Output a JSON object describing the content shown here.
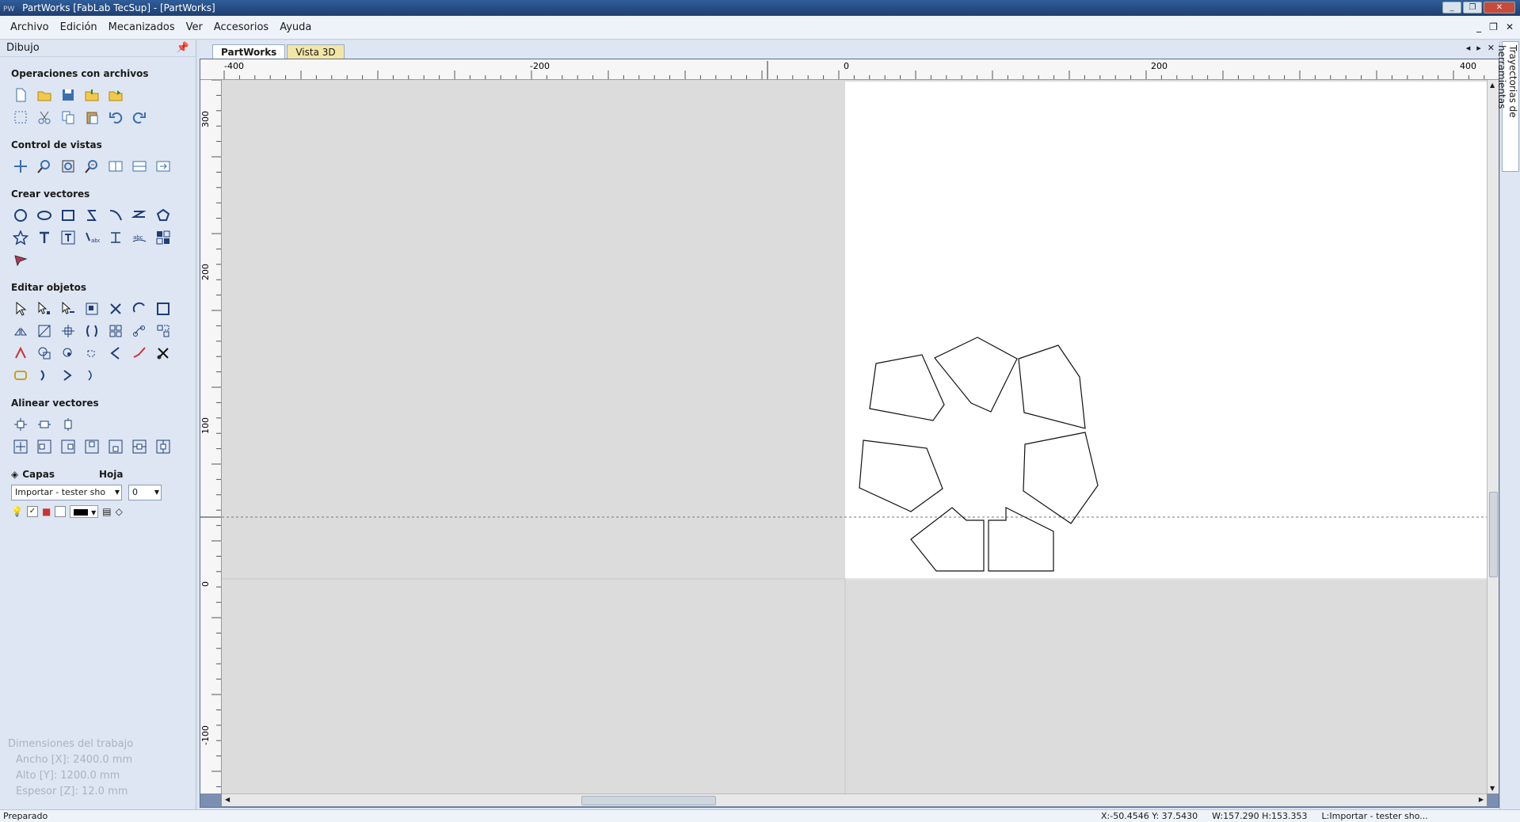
{
  "window": {
    "title": "PartWorks [FabLab TecSup] - [PartWorks]",
    "app_icon": "PW"
  },
  "menu": [
    "Archivo",
    "Edición",
    "Mecanizados",
    "Ver",
    "Accesorios",
    "Ayuda"
  ],
  "left_panel": {
    "title": "Dibujo",
    "sections": {
      "file_ops": "Operaciones con archivos",
      "view_control": "Control de vistas",
      "create_vectors": "Crear vectores",
      "edit_objects": "Editar objetos",
      "align_vectors": "Alinear vectores"
    },
    "layers": {
      "title": "Capas",
      "sheet_title": "Hoja",
      "layer_selected": "Importar - tester sho",
      "sheet_selected": "0"
    },
    "job_dimensions": {
      "title": "Dimensiones del trabajo",
      "width": "Ancho   [X]: 2400.0 mm",
      "height": "Alto    [Y]: 1200.0 mm",
      "thickness": "Espesor [Z]: 12.0 mm"
    }
  },
  "tabs": [
    {
      "label": "PartWorks",
      "active": true
    },
    {
      "label": "Vista 3D",
      "active": false
    }
  ],
  "rulers": {
    "horizontal_labels": [
      "-400",
      "-200",
      "0",
      "200",
      "400"
    ],
    "vertical_labels": [
      "300",
      "200",
      "100",
      "0",
      "-100"
    ]
  },
  "right_panel": {
    "tab_label": "Trayectorias de herramientas"
  },
  "status": {
    "message": "Preparado",
    "cursor": "X:-50.4546 Y: 37.5430",
    "dimensions": "W:157.290   H:153.353",
    "layer": "L:Importar - tester sho..."
  },
  "colors": {
    "panel_bg": "#dde6f2",
    "canvas_bg": "#dcdcdc",
    "material_bg": "#ffffff",
    "title_bar": "#2f5d9a"
  }
}
